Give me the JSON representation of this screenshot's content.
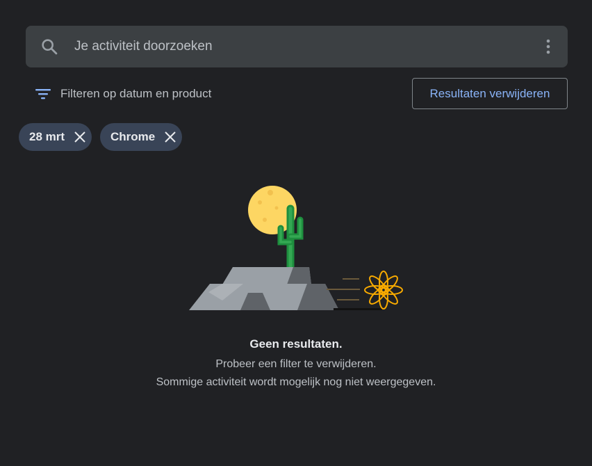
{
  "search": {
    "placeholder": "Je activiteit doorzoeken",
    "search_icon": "search-icon",
    "more_icon": "more-vert-icon"
  },
  "filter": {
    "label": "Filteren op datum en product",
    "icon": "filter-list-icon",
    "accent_color": "#8ab4f8"
  },
  "delete_button": {
    "label": "Resultaten verwijderen"
  },
  "chips": [
    {
      "label": "28 mrt",
      "close_icon": "close-icon"
    },
    {
      "label": "Chrome",
      "close_icon": "close-icon"
    }
  ],
  "empty_state": {
    "illustration": "desert-cactus-illustration",
    "title": "Geen resultaten.",
    "line1": "Probeer een filter te verwijderen.",
    "line2": "Sommige activiteit wordt mogelijk nog niet weergegeven."
  },
  "colors": {
    "background": "#202124",
    "surface": "#3c4043",
    "chip": "#394457",
    "accent": "#8ab4f8"
  }
}
